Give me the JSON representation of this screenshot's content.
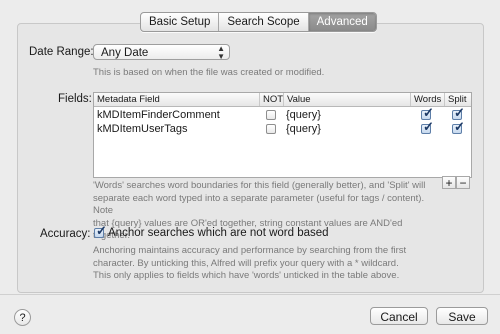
{
  "tabs": [
    {
      "label": "Basic Setup",
      "active": false
    },
    {
      "label": "Search Scope",
      "active": false
    },
    {
      "label": "Advanced",
      "active": true
    }
  ],
  "date_range": {
    "label": "Date Range:",
    "value": "Any Date",
    "help": "This is based on when the file was created or modified."
  },
  "fields": {
    "label": "Fields:",
    "columns": {
      "field": "Metadata Field",
      "not": "NOT",
      "value": "Value",
      "words": "Words",
      "split": "Split"
    },
    "rows": [
      {
        "field": "kMDItemFinderComment",
        "not": false,
        "value": "{query}",
        "words": true,
        "split": true
      },
      {
        "field": "kMDItemUserTags",
        "not": false,
        "value": "{query}",
        "words": true,
        "split": true
      }
    ],
    "add_label": "+",
    "remove_label": "−",
    "help_lines": [
      "'Words' searches word boundaries for this field (generally better), and 'Split' will",
      "separate each word typed into a separate parameter (useful for tags / content). Note",
      "that {query} values are OR'ed together, string constant values are AND'ed together."
    ]
  },
  "accuracy": {
    "label": "Accuracy:",
    "checkbox_label": "Anchor searches which are not word based",
    "checked": true,
    "help_lines": [
      "Anchoring maintains accuracy and performance by searching from the first",
      "character. By unticking this, Alfred will prefix your query with a * wildcard.",
      "This only applies to fields which have 'words' unticked in the table above."
    ]
  },
  "footer": {
    "help_label": "?",
    "cancel_label": "Cancel",
    "save_label": "Save"
  }
}
